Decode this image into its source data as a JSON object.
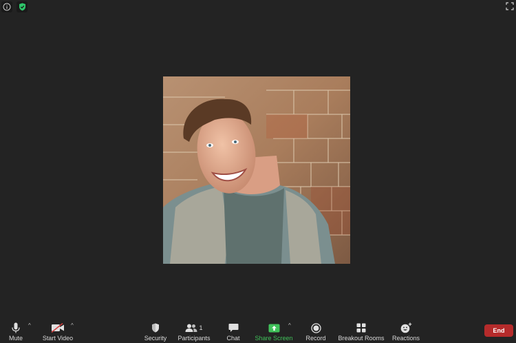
{
  "toolbar": {
    "mute_label": "Mute",
    "start_video_label": "Start Video",
    "security_label": "Security",
    "participants_label": "Participants",
    "participants_count": "1",
    "chat_label": "Chat",
    "share_screen_label": "Share Screen",
    "record_label": "Record",
    "breakout_rooms_label": "Breakout Rooms",
    "reactions_label": "Reactions",
    "end_label": "End"
  },
  "colors": {
    "background": "#232323",
    "share_green": "#40c15a",
    "end_red": "#b52b2b",
    "shield_green": "#2ec56a"
  },
  "icons": {
    "top_left": [
      "info-icon",
      "shield-check-icon"
    ],
    "top_right": "fullscreen-icon",
    "toolbar": [
      "microphone-icon",
      "video-off-icon",
      "shield-icon",
      "participants-icon",
      "chat-icon",
      "share-screen-icon",
      "record-icon",
      "breakout-rooms-icon",
      "reactions-icon"
    ]
  }
}
